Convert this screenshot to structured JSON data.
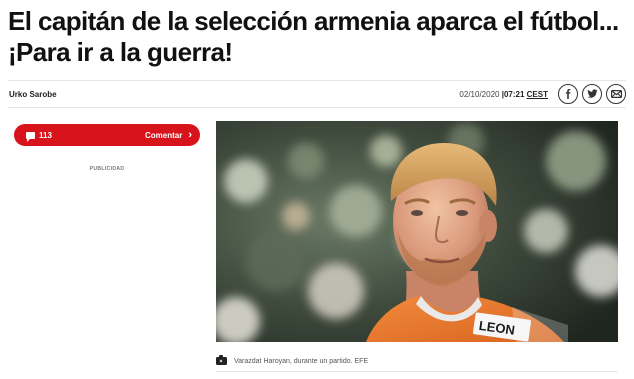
{
  "article": {
    "headline": "El capitán de la selección armenia aparca el fútbol...¡Para ir a la guerra!",
    "author": "Urko Sarobe",
    "date": "02/10/2020",
    "time_sep": "|",
    "time": "07:21",
    "timezone": "CEST"
  },
  "share": {
    "icons": [
      "facebook-icon",
      "twitter-icon",
      "email-icon"
    ],
    "color": "#333333"
  },
  "comments": {
    "count": "113",
    "label": "Comentar",
    "chevron": "›",
    "color": "#d7131c"
  },
  "ad": {
    "label": "PUBLICIDAD"
  },
  "image": {
    "jersey_text": "LEON",
    "caption": "Varazdat Haroyan, durante un partido. EFE"
  }
}
